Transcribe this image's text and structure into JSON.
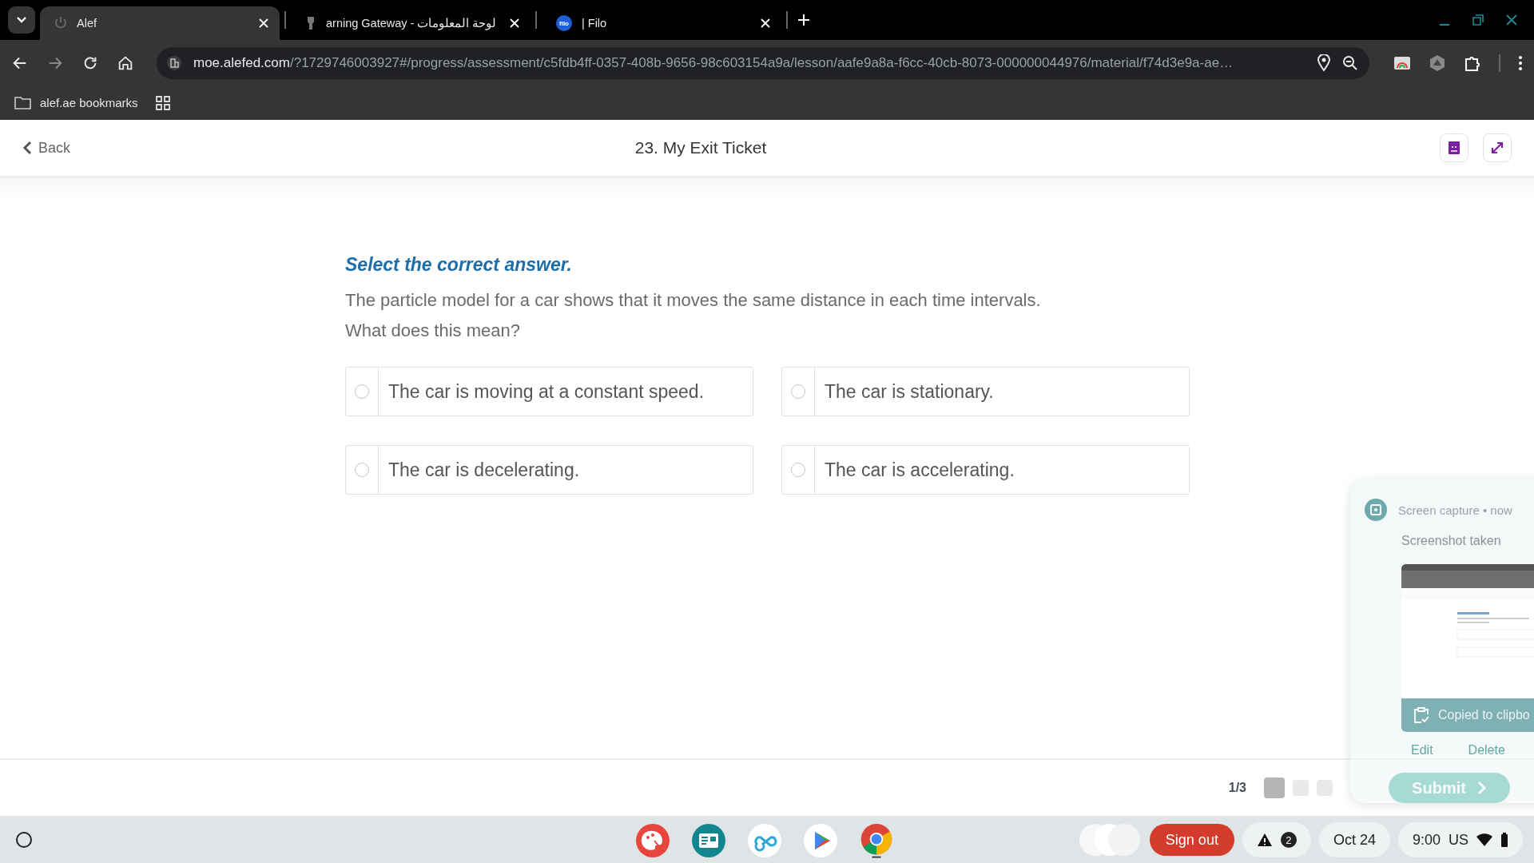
{
  "browser": {
    "tabs": [
      {
        "title": "Alef",
        "selected": true,
        "kind": "power"
      },
      {
        "title": "arning Gateway - لوحة المعلومات",
        "selected": false,
        "kind": "torch"
      },
      {
        "title": "| Filo",
        "selected": false,
        "kind": "badge",
        "badge": "filo"
      }
    ],
    "address": {
      "domain": "moe.alefed.com",
      "path": "/?1729746003927#/progress/assessment/c5fdb4ff-0357-408b-9656-98c603154a9a/lesson/aafe9a8a-f6cc-40cb-8073-000000044976/material/f74d3e9a-ae…"
    },
    "bookmarks": [
      {
        "label": "alef.ae bookmarks"
      }
    ]
  },
  "header": {
    "back": "Back",
    "title": "23. My Exit Ticket"
  },
  "question": {
    "instruction": "Select the correct answer.",
    "text": "The particle model for a car shows that it moves the same distance in each time intervals.",
    "prompt": "What does this mean?"
  },
  "options": [
    {
      "label": "The car is moving at a constant speed.",
      "selected": false
    },
    {
      "label": "The car is stationary.",
      "selected": false
    },
    {
      "label": "The car is decelerating.",
      "selected": false
    },
    {
      "label": "The car is accelerating.",
      "selected": false
    }
  ],
  "pager": {
    "count": "1/3",
    "pages": [
      {
        "selected": true
      },
      {
        "selected": false
      },
      {
        "selected": false
      }
    ]
  },
  "submit": "Submit",
  "notification": {
    "source": "Screen capture",
    "separator": "•",
    "time": "now",
    "title": "Screenshot taken",
    "banner": "Copied to clipbo",
    "actions": [
      "Edit",
      "Delete"
    ]
  },
  "shelf": {
    "sign_out": "Sign out",
    "alert_count": "2",
    "date": "Oct 24",
    "time": "9:00",
    "locale": "US"
  }
}
